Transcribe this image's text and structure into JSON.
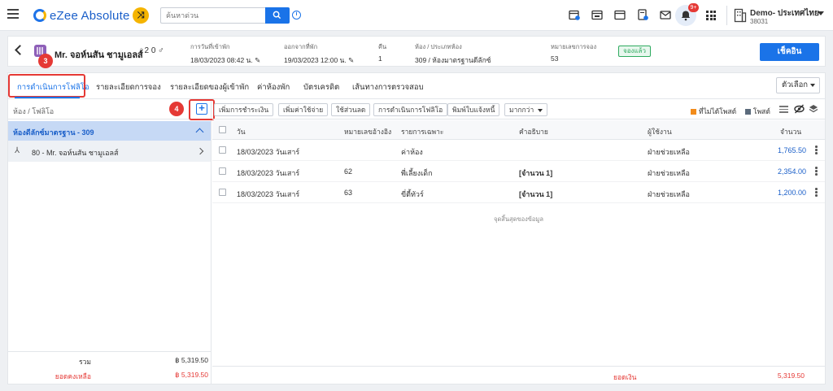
{
  "app": {
    "title": "eZee Absolute",
    "search_placeholder": "ค้นหาด่วน",
    "notification_count": "9+",
    "property_name": "Demo- ประเทศไทย",
    "property_id": "38031"
  },
  "reservation": {
    "guest_name": "Mr. จอห์นสัน ชามูเอลส์",
    "pax": "2 0",
    "arrival_label": "การวันที่เข้าพัก",
    "arrival_value": "18/03/2023 08:42 น.",
    "departure_label": "ออกจากที่พัก",
    "departure_value": "19/03/2023 12:00 น.",
    "nights_label": "คืน",
    "nights_value": "1",
    "room_label": "ห้อง / ประเภทห้อง",
    "room_value": "309 / ห้องมาตรฐานดีลักซ์",
    "res_no_label": "หมายเลขการจอง",
    "res_no_value": "53",
    "status": "จองแล้ว",
    "checkin_label": "เช็คอิน"
  },
  "steps": {
    "three": "3",
    "four": "4"
  },
  "tabs": [
    {
      "label": "การดำเนินการโฟลิโอ"
    },
    {
      "label": "รายละเอียดการจอง"
    },
    {
      "label": "รายละเอียดของผู้เข้าพัก"
    },
    {
      "label": "ค่าห้องพัก"
    },
    {
      "label": "บัตรเครดิต"
    },
    {
      "label": "เส้นทางการตรวจสอบ"
    }
  ],
  "options_label": "ตัวเลือก",
  "left_panel": {
    "title": "ห้อง / โฟลิโอ",
    "group_label": "ห้องดีลักซ์มาตรฐาน - 309",
    "folio_label": "80 - Mr. จอห์นสัน ชามูเอลส์",
    "total_label": "รวม",
    "total_value": "฿ 5,319.50",
    "balance_label": "ยอดคงเหลือ",
    "balance_value": "฿ 5,319.50"
  },
  "toolbar": {
    "add_payment": "เพิ่มการชำระเงิน",
    "add_charge": "เพิ่มค่าใช้จ่าย",
    "discount": "ใช้ส่วนลด",
    "folio_ops": "การดำเนินการโฟลิโอ",
    "print_invoice": "พิมพ์ใบแจ้งหนี้",
    "more": "มากกว่า",
    "legend_unposted": "ที่ไม่ได้โพสต์",
    "legend_posted": "โพสต์"
  },
  "colors": {
    "unposted": "#f28c1b",
    "posted": "#5b6b7c",
    "accent": "#1a73e8",
    "alert": "#e53935"
  },
  "table": {
    "headers": {
      "date": "วัน",
      "ref": "หมายเลขอ้างอิง",
      "particular": "รายการเฉพาะ",
      "desc": "คำอธิบาย",
      "user": "ผู้ใช้งาน",
      "amount": "จำนวน"
    },
    "rows": [
      {
        "date": "18/03/2023 วันเสาร์",
        "ref": "",
        "particular": "ค่าห้อง",
        "desc": "",
        "user": "ฝ่ายช่วยเหลือ",
        "amount": "1,765.50"
      },
      {
        "date": "18/03/2023 วันเสาร์",
        "ref": "62",
        "particular": "พี่เลี้ยงเด็ก",
        "desc": "[จำนวน 1]",
        "user": "ฝ่ายช่วยเหลือ",
        "amount": "2,354.00"
      },
      {
        "date": "18/03/2023 วันเสาร์",
        "ref": "63",
        "particular": "ขี่ตี้ทัวร์",
        "desc": "[จำนวน 1]",
        "user": "ฝ่ายช่วยเหลือ",
        "amount": "1,200.00"
      }
    ],
    "end_message": "จุดสิ้นสุดของข้อมูล",
    "footer_label": "ยอดเงิน",
    "footer_value": "5,319.50"
  }
}
